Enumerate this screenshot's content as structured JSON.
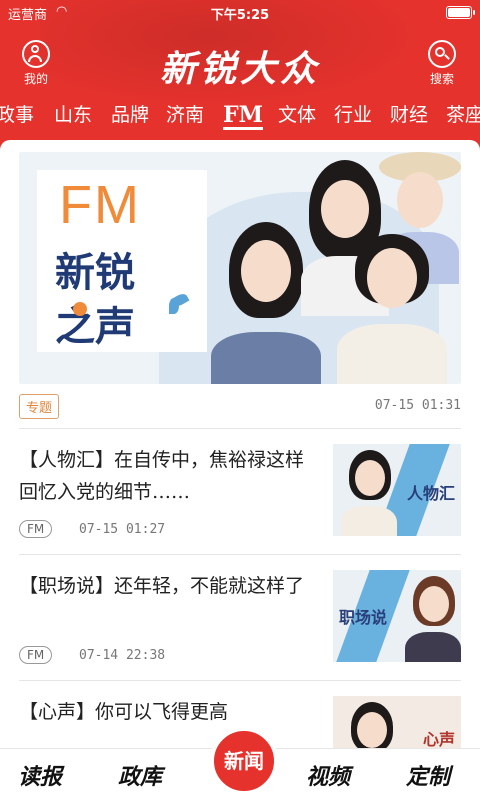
{
  "status_bar": {
    "carrier": "运营商",
    "time": "下午5:25",
    "battery_level": 0.9
  },
  "header": {
    "logo": "新锐大众",
    "me_label": "我的",
    "search_label": "搜索"
  },
  "tabs": [
    {
      "label": "政事"
    },
    {
      "label": "山东"
    },
    {
      "label": "品牌"
    },
    {
      "label": "济南"
    },
    {
      "label": "FM",
      "active": true
    },
    {
      "label": "文体"
    },
    {
      "label": "行业"
    },
    {
      "label": "财经"
    },
    {
      "label": "茶座"
    }
  ],
  "banner": {
    "fm": "FM",
    "title_line1": "新锐",
    "title_line2": "之声",
    "tag": "专题",
    "time": "07-15 01:31"
  },
  "articles": [
    {
      "title": "【人物汇】在自传中，焦裕禄这样回忆入党的细节……",
      "source": "FM",
      "time": "07-15 01:27",
      "thumb_label": "人物汇"
    },
    {
      "title": "【职场说】还年轻，不能就这样了",
      "source": "FM",
      "time": "07-14 22:38",
      "thumb_label": "职场说"
    },
    {
      "title": "【心声】你可以飞得更高",
      "thumb_label": "心声"
    }
  ],
  "bottom_nav": {
    "items": [
      {
        "label": "读报"
      },
      {
        "label": "政库"
      },
      {
        "label": "新闻"
      },
      {
        "label": "视频"
      },
      {
        "label": "定制"
      }
    ]
  },
  "colors": {
    "brand_red": "#e5322d",
    "accent_orange": "#f08b3a",
    "navy": "#1f3a74"
  }
}
